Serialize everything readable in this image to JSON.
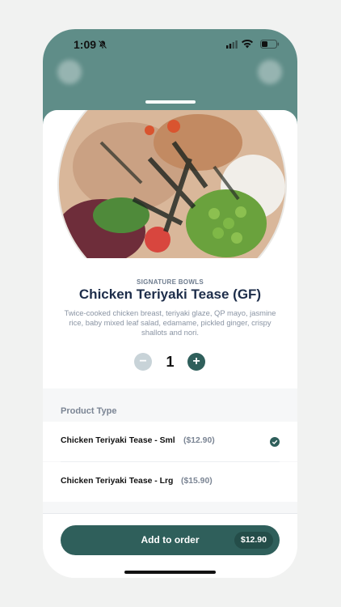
{
  "status_bar": {
    "time": "1:09"
  },
  "product": {
    "category": "SIGNATURE BOWLS",
    "title": "Chicken Teriyaki Tease (GF)",
    "description": "Twice-cooked chicken breast, teriyaki glaze, QP mayo, jasmine rice, baby mixed leaf salad, edamame, pickled ginger, crispy shallots and nori.",
    "image_icon": "food-bowl-image"
  },
  "quantity": {
    "minus": "−",
    "value": "1",
    "plus": "+"
  },
  "options": {
    "section_label": "Product Type",
    "items": [
      {
        "name": "Chicken Teriyaki Tease - Sml",
        "price": "($12.90)",
        "selected": true
      },
      {
        "name": "Chicken Teriyaki Tease - Lrg",
        "price": "($15.90)",
        "selected": false
      }
    ]
  },
  "footer": {
    "add_label": "Add to order",
    "total": "$12.90"
  },
  "colors": {
    "header_bg": "#5f8d88",
    "accent": "#2f5f5b",
    "title_text": "#1d2d4a",
    "muted_text": "#7b8594"
  }
}
